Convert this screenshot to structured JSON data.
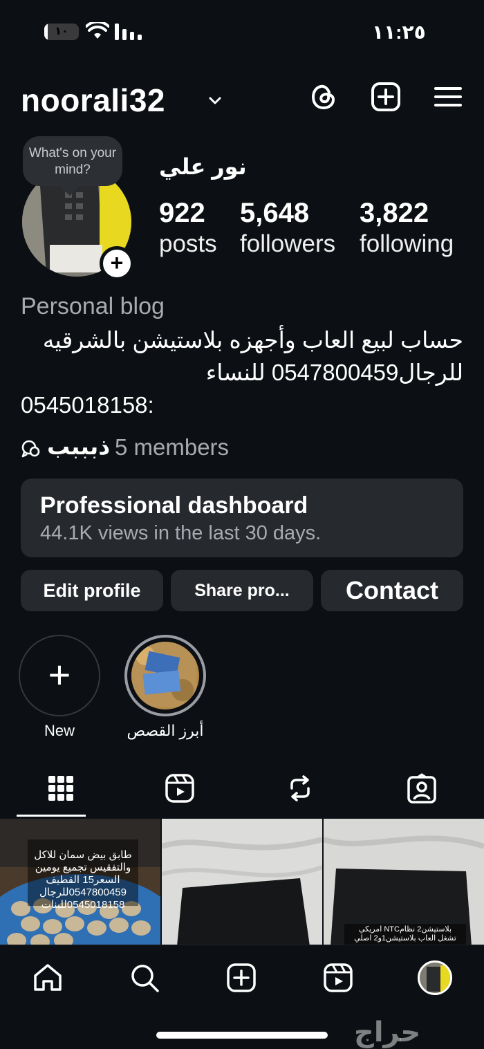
{
  "status_bar": {
    "time": "١١:٢٥",
    "battery": "١٠",
    "battery_level": 0.1
  },
  "header": {
    "username": "noorali32",
    "icons": [
      "chevron-down-icon",
      "threads-icon",
      "plus-square-icon",
      "menu-icon"
    ]
  },
  "profile": {
    "note_bubble": "What's on your mind?",
    "display_name": "نور علي",
    "stats": [
      {
        "value": "922",
        "label": "posts"
      },
      {
        "value": "5,648",
        "label": "followers"
      },
      {
        "value": "3,822",
        "label": "following"
      }
    ],
    "category": "Personal blog",
    "bio_lines": [
      "حساب لبيع العاب وأجهزه بلاستيشن بالشرقيه",
      "للرجال0547800459 للنساء",
      "0545018158:"
    ],
    "channel": {
      "name": "ذبببب",
      "members": "5 members"
    }
  },
  "dashboard": {
    "title": "Professional dashboard",
    "subtitle": "44.1K views in the last 30 days."
  },
  "buttons": {
    "edit_profile": "Edit profile",
    "share_profile": "Share pro...",
    "contact": "Contact"
  },
  "highlights": [
    {
      "label": "New"
    },
    {
      "label": "أبرز القصص"
    }
  ],
  "tabs": [
    "grid-icon",
    "reels-icon",
    "reposts-icon",
    "tagged-icon"
  ],
  "grid": [
    {
      "overlay": [
        "طابق بيض سمان للاكل",
        "والتفقيس تجميع يومين",
        "السعر15 القطيف",
        "0547800459للرجال",
        "0545018158للبنات"
      ]
    },
    {
      "overlay": []
    },
    {
      "overlay": [
        "بلاستيشن2 نظامNTC امريكي",
        "تشغل العاب بلاستيشن1و2 اصلي"
      ]
    }
  ],
  "bottom_nav": [
    "home-icon",
    "search-icon",
    "create-icon",
    "reels-icon",
    "profile-avatar"
  ],
  "watermark": "حراج"
}
